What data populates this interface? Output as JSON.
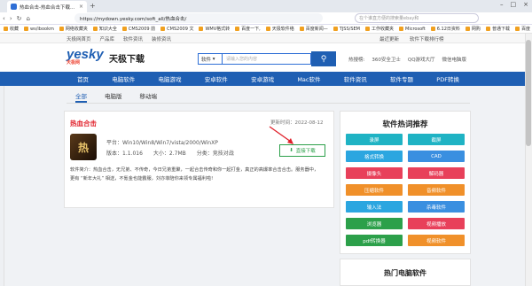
{
  "browser": {
    "tab_title": "热血合击-热血合击下载...",
    "url": "https://mydown.yesky.com/soft_all/热血合击/",
    "search_placeholder": "在个谁直方便的搜索量ebay和",
    "bookmarks": [
      "收藏",
      "ws/ibookm",
      "网络收藏夹",
      "知识大全",
      "CMS2009 前",
      "CMS2009 文",
      "WMV格式转",
      "百度一下,",
      "天极软件络",
      "百度新闻—",
      "TJSS/SEM",
      "工作收藏夹",
      "Microsoft",
      "6.12日资料",
      "网购",
      "普通下载",
      "百度"
    ]
  },
  "site": {
    "toplinks": [
      "天极网首页",
      "产品库",
      "软件资讯",
      "装修资讯"
    ],
    "topright": [
      "最近更新",
      "软件下载排行榜"
    ],
    "logo": "yesky",
    "logo_sub": "天极网",
    "logo_text": "天极下载",
    "search_select": "软件",
    "search_placeholder": "请输入您的内容",
    "hot_label": "热搜榜:",
    "hot": [
      "360安全卫士",
      "QQ游戏大厅",
      "微信电脑版"
    ],
    "nav": [
      "首页",
      "电脑软件",
      "电脑游戏",
      "安卓软件",
      "安卓游戏",
      "Mac软件",
      "软件资讯",
      "软件专题",
      "PDF转换"
    ],
    "subtabs": [
      "全部",
      "电脑版",
      "移动端"
    ]
  },
  "app": {
    "title": "热血合击",
    "updated": "更新时间：2022-08-12",
    "icon_text": "热",
    "platform": "平台：Win10/Win8/Win7/vista/2000/WinXP",
    "version": "版本：1.1.016",
    "size": "大小：2.7MB",
    "category": "分类：竞技对战",
    "download": "直接下载",
    "desc1": "软件简介：热血合击，无兄弟、不传奇，今日兄弟重聚，一起合击传奇和你一起打金，真正的高爆率合击合击。服务器中，",
    "desc2": "更有 “新年大礼” 相送，不氪金也能霸服，刘亦菲陪你来领专属福利啦!"
  },
  "sidebar": {
    "title": "软件热词推荐",
    "tiles": [
      {
        "label": "录屏",
        "color": "#1fb3c4"
      },
      {
        "label": "截屏",
        "color": "#1fb3c4"
      },
      {
        "label": "格式转换",
        "color": "#2ba6e0"
      },
      {
        "label": "CAD",
        "color": "#3a8fe0"
      },
      {
        "label": "摄像头",
        "color": "#e8405a"
      },
      {
        "label": "解码器",
        "color": "#e8405a"
      },
      {
        "label": "压缩软件",
        "color": "#f0902a"
      },
      {
        "label": "音频软件",
        "color": "#f0902a"
      },
      {
        "label": "输入法",
        "color": "#2ba6e0"
      },
      {
        "label": "杀毒软件",
        "color": "#3a8fe0"
      },
      {
        "label": "浏览器",
        "color": "#2ca04a"
      },
      {
        "label": "视频播放",
        "color": "#e8405a"
      },
      {
        "label": "pdf转换器",
        "color": "#2ca04a"
      },
      {
        "label": "视频软件",
        "color": "#f0902a"
      }
    ],
    "title2": "热门电脑软件"
  }
}
